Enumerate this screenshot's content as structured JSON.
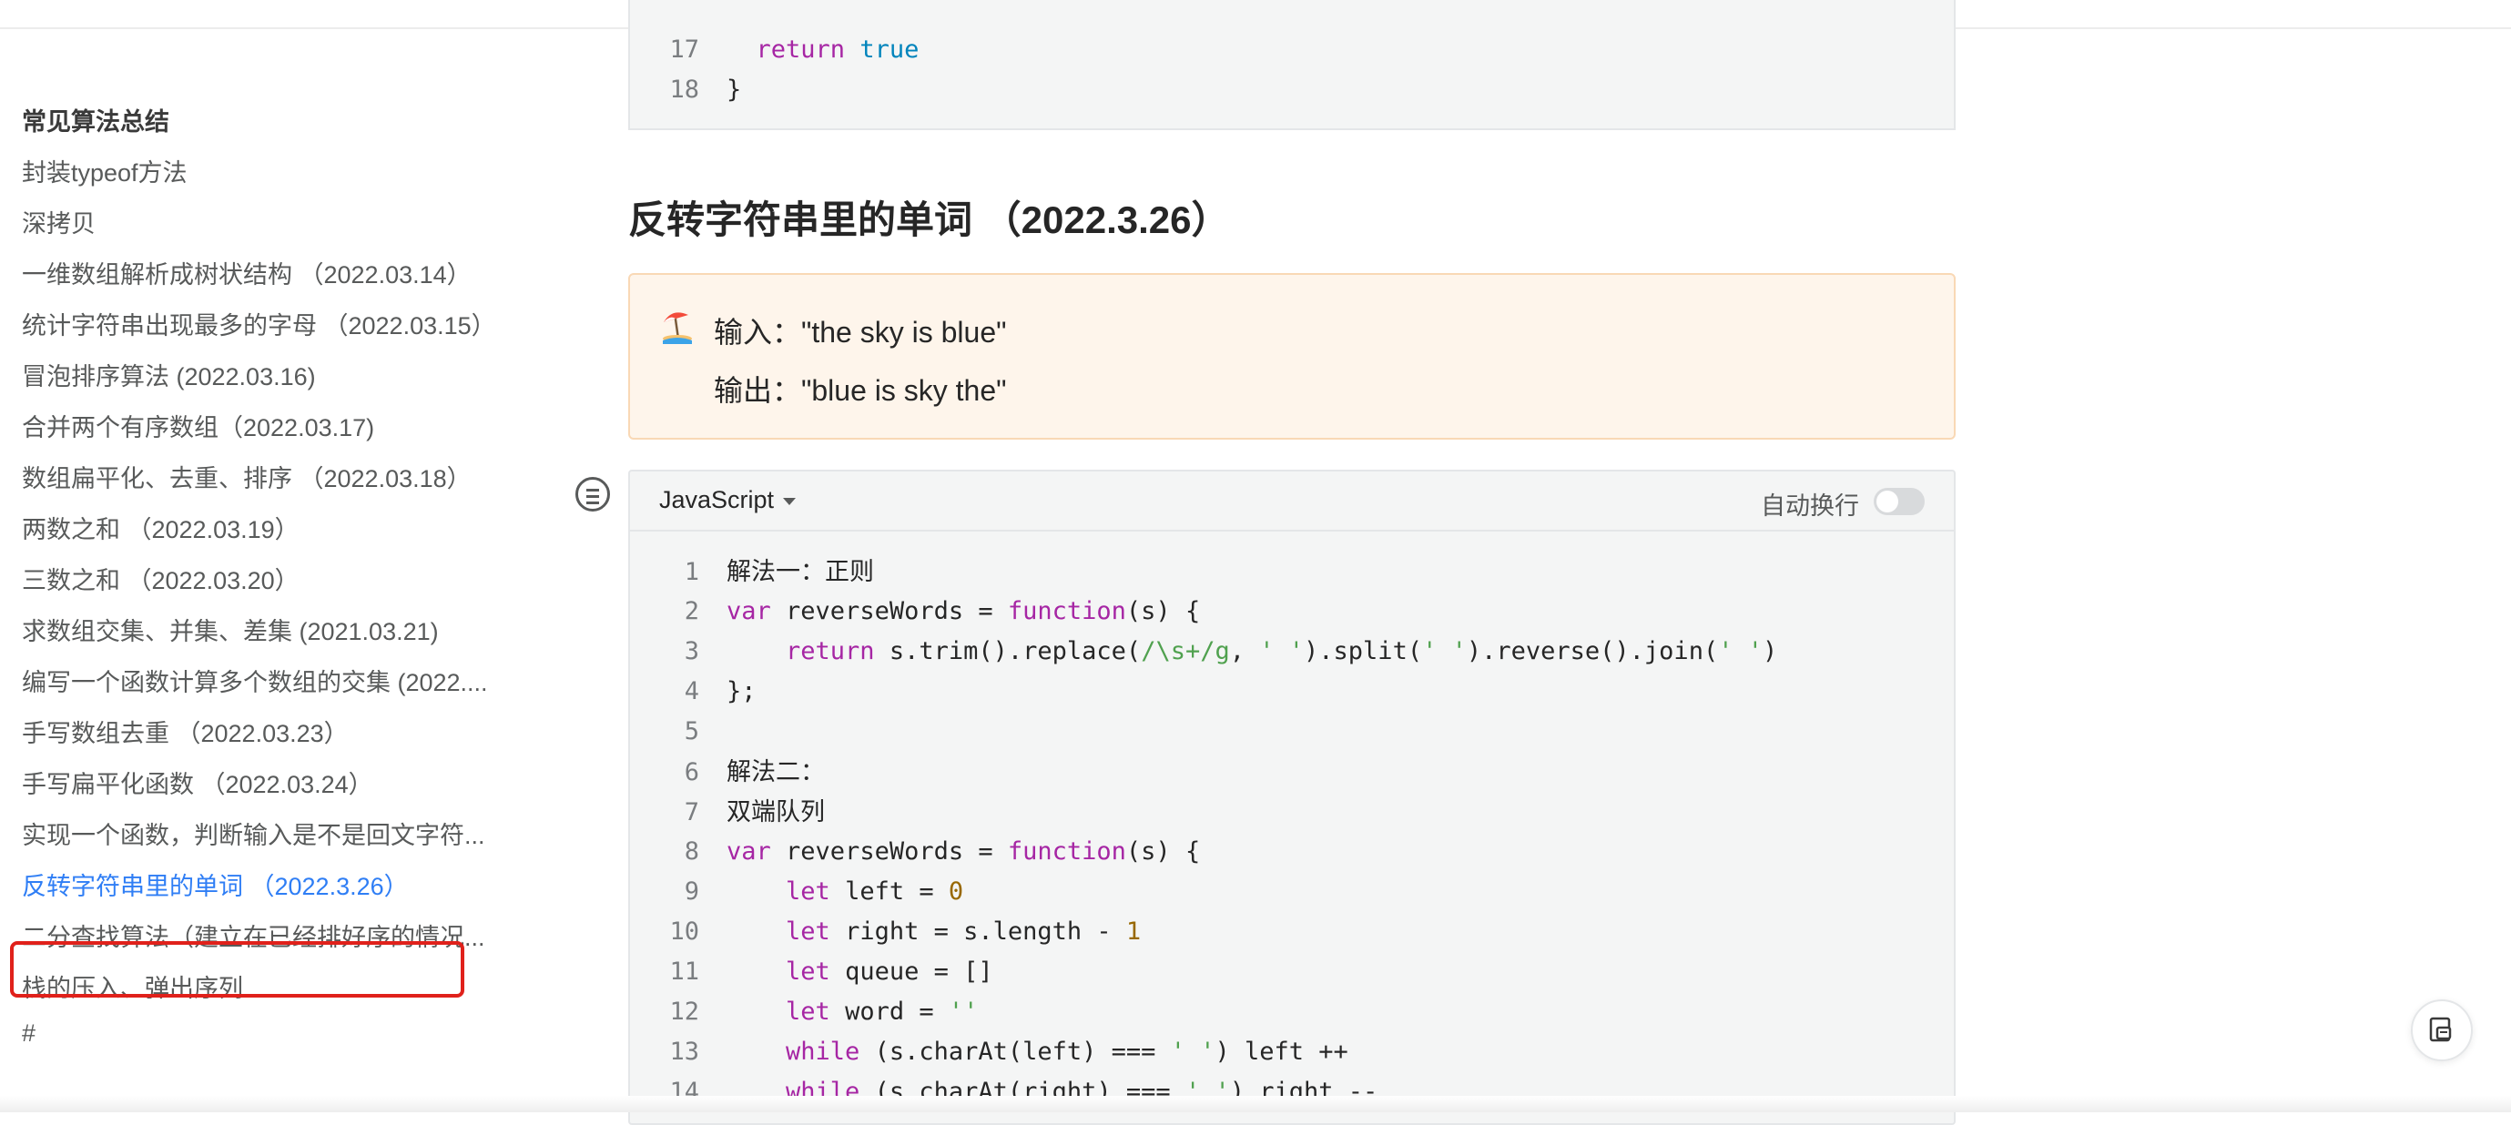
{
  "sidebar": {
    "heading": "常见算法总结",
    "items": [
      {
        "label": "封装typeof方法"
      },
      {
        "label": "深拷贝"
      },
      {
        "label": "一维数组解析成树状结构 （2022.03.14）"
      },
      {
        "label": "统计字符串出现最多的字母 （2022.03.15）"
      },
      {
        "label": "冒泡排序算法 (2022.03.16)"
      },
      {
        "label": "合并两个有序数组（2022.03.17)"
      },
      {
        "label": "数组扁平化、去重、排序 （2022.03.18）"
      },
      {
        "label": "两数之和 （2022.03.19）"
      },
      {
        "label": "三数之和 （2022.03.20）"
      },
      {
        "label": "求数组交集、并集、差集 (2021.03.21)"
      },
      {
        "label": "编写一个函数计算多个数组的交集 (2022...."
      },
      {
        "label": "手写数组去重 （2022.03.23）"
      },
      {
        "label": "手写扁平化函数 （2022.03.24）"
      },
      {
        "label": "实现一个函数，判断输入是不是回文字符..."
      },
      {
        "label": "反转字符串里的单词 （2022.3.26）",
        "active": true
      },
      {
        "label": "二分查找算法（建立在已经排好序的情况..."
      },
      {
        "label": "栈的压入、弹出序列"
      },
      {
        "label": "#"
      }
    ]
  },
  "top_code": {
    "lines": [
      {
        "n": "17",
        "parts": [
          {
            "t": "  "
          },
          {
            "t": "return",
            "c": "kw"
          },
          {
            "t": " "
          },
          {
            "t": "true",
            "c": "bool"
          }
        ]
      },
      {
        "n": "18",
        "parts": [
          {
            "t": "}"
          }
        ]
      }
    ]
  },
  "section": {
    "title": "反转字符串里的单词 （2022.3.26）"
  },
  "callout": {
    "emoji": "beach-umbrella-icon",
    "input_line": "输入：\"the sky is blue\"",
    "output_line": "输出：\"blue is sky the\""
  },
  "code_block": {
    "language": "JavaScript",
    "wrap_label": "自动换行",
    "wrap_enabled": false,
    "lines": [
      {
        "n": "1",
        "parts": [
          {
            "t": "解法一：正则",
            "c": "cn"
          }
        ]
      },
      {
        "n": "2",
        "parts": [
          {
            "t": "var",
            "c": "kw"
          },
          {
            "t": " reverseWords = "
          },
          {
            "t": "function",
            "c": "kw"
          },
          {
            "t": "(s) {"
          }
        ]
      },
      {
        "n": "3",
        "parts": [
          {
            "t": "    "
          },
          {
            "t": "return",
            "c": "kw"
          },
          {
            "t": " s.trim().replace("
          },
          {
            "t": "/\\s+/g",
            "c": "str"
          },
          {
            "t": ", "
          },
          {
            "t": "' '",
            "c": "str"
          },
          {
            "t": ").split("
          },
          {
            "t": "' '",
            "c": "str"
          },
          {
            "t": ").reverse().join("
          },
          {
            "t": "' '",
            "c": "str"
          },
          {
            "t": ")"
          }
        ]
      },
      {
        "n": "4",
        "parts": [
          {
            "t": "};"
          }
        ]
      },
      {
        "n": "5",
        "parts": [
          {
            "t": ""
          }
        ]
      },
      {
        "n": "6",
        "parts": [
          {
            "t": "解法二：",
            "c": "cn"
          }
        ]
      },
      {
        "n": "7",
        "parts": [
          {
            "t": "双端队列",
            "c": "cn"
          }
        ]
      },
      {
        "n": "8",
        "parts": [
          {
            "t": "var",
            "c": "kw"
          },
          {
            "t": " reverseWords = "
          },
          {
            "t": "function",
            "c": "kw"
          },
          {
            "t": "(s) {"
          }
        ]
      },
      {
        "n": "9",
        "parts": [
          {
            "t": "    "
          },
          {
            "t": "let",
            "c": "kw"
          },
          {
            "t": " left = "
          },
          {
            "t": "0",
            "c": "num"
          }
        ]
      },
      {
        "n": "10",
        "parts": [
          {
            "t": "    "
          },
          {
            "t": "let",
            "c": "kw"
          },
          {
            "t": " right = s.length - "
          },
          {
            "t": "1",
            "c": "num"
          }
        ]
      },
      {
        "n": "11",
        "parts": [
          {
            "t": "    "
          },
          {
            "t": "let",
            "c": "kw"
          },
          {
            "t": " queue = []"
          }
        ]
      },
      {
        "n": "12",
        "parts": [
          {
            "t": "    "
          },
          {
            "t": "let",
            "c": "kw"
          },
          {
            "t": " word = "
          },
          {
            "t": "''",
            "c": "str"
          }
        ]
      },
      {
        "n": "13",
        "parts": [
          {
            "t": "    "
          },
          {
            "t": "while",
            "c": "kw"
          },
          {
            "t": " (s.charAt(left) === "
          },
          {
            "t": "' '",
            "c": "str"
          },
          {
            "t": ") left ++"
          }
        ]
      },
      {
        "n": "14",
        "parts": [
          {
            "t": "    "
          },
          {
            "t": "while",
            "c": "kw"
          },
          {
            "t": " (s.charAt(right) === "
          },
          {
            "t": "' '",
            "c": "str"
          },
          {
            "t": ") right --"
          }
        ]
      }
    ]
  },
  "floating_button": {
    "icon": "feedback-icon"
  }
}
